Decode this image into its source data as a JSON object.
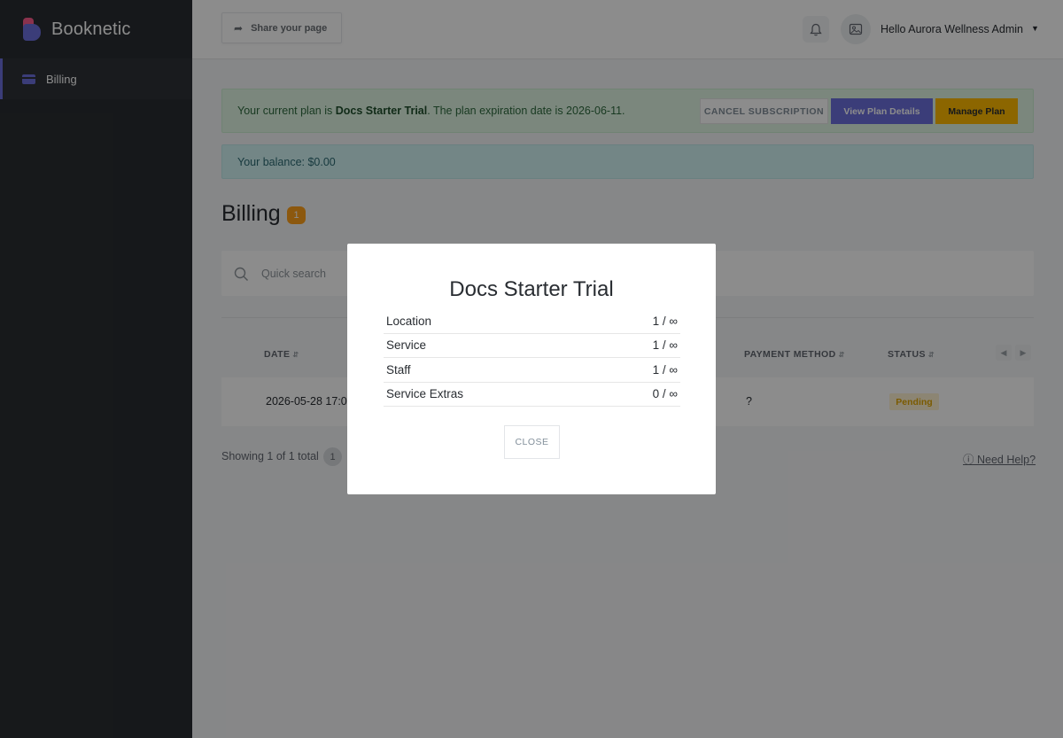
{
  "app": {
    "name": "Booknetic"
  },
  "sidebar": {
    "items": [
      {
        "label": "Billing"
      }
    ]
  },
  "topbar": {
    "share_label": "Share your page",
    "user_greeting": "Hello Aurora Wellness Admin"
  },
  "plan_alert": {
    "prefix": "Your current plan is ",
    "plan_name": "Docs Starter Trial",
    "suffix": ". The plan expiration date is 2026-06-11.",
    "cancel_label": "CANCEL SUBSCRIPTION",
    "view_label": "View Plan Details",
    "manage_label": "Manage Plan"
  },
  "balance": {
    "text": "Your balance: $0.00"
  },
  "page": {
    "title": "Billing",
    "count": "1"
  },
  "search": {
    "placeholder": "Quick search"
  },
  "table": {
    "columns": [
      "DATE",
      "PAYMENT METHOD",
      "STATUS"
    ],
    "rows": [
      {
        "date": "2026-05-28 17:0",
        "payment_method": "?",
        "status": "Pending"
      }
    ]
  },
  "footer": {
    "showing": "Showing 1 of 1 total",
    "page": "1",
    "help": "Need Help?"
  },
  "modal": {
    "title": "Docs Starter Trial",
    "limits": [
      {
        "name": "Location",
        "value": "1 / ∞"
      },
      {
        "name": "Service",
        "value": "1 / ∞"
      },
      {
        "name": "Staff",
        "value": "1 / ∞"
      },
      {
        "name": "Service Extras",
        "value": "0 / ∞"
      }
    ],
    "close_label": "CLOSE"
  },
  "colors": {
    "sidebar_bg": "#292d32",
    "accent": "#6c70dc",
    "manage": "#ffbb00",
    "pending": "#e0a500"
  }
}
